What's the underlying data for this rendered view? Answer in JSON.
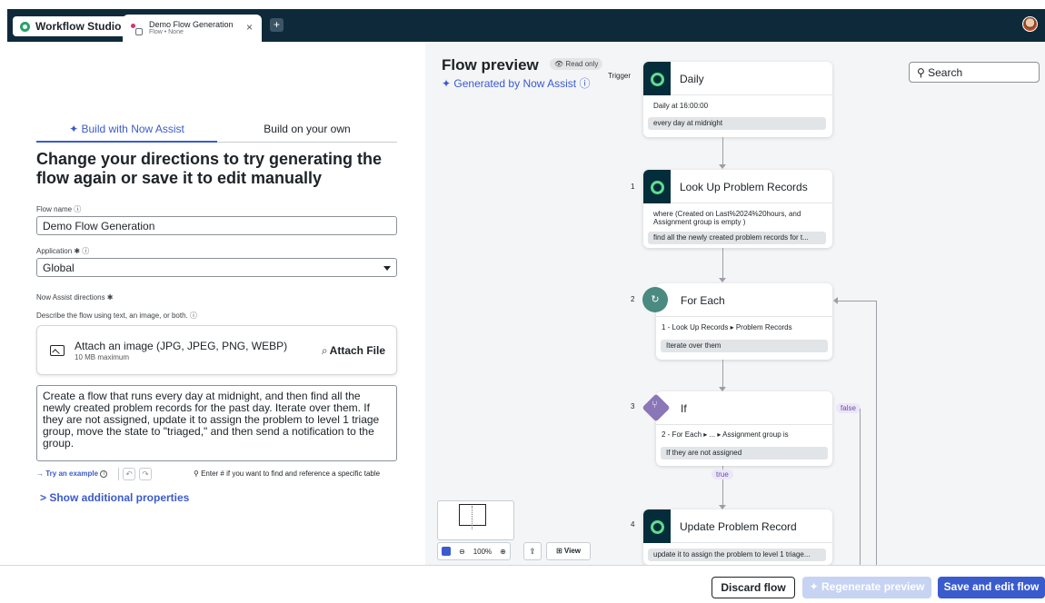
{
  "topbar": {
    "app_name": "Workflow Studio",
    "tab_title": "Demo Flow Generation",
    "tab_subtitle": "Flow • None",
    "tab_close": "×",
    "tab_add": "+"
  },
  "builder": {
    "tabs": [
      {
        "label": "✦ Build with Now Assist",
        "active": true
      },
      {
        "label": "Build on your own",
        "active": false
      }
    ],
    "heading": "Change your directions to try generating the flow again or save it to edit manually",
    "flow_name_label": "Flow name ⓘ",
    "flow_name_value": "Demo Flow Generation",
    "application_label": "Application ✱ ⓘ",
    "application_value": "Global",
    "directions_label": "Now Assist directions ✱",
    "directions_sublabel": "Describe the flow using text, an image, or both. ⓘ",
    "attach_title": "Attach an image (JPG, JPEG, PNG, WEBP)",
    "attach_subtitle": "10 MB maximum",
    "attach_button": "Attach File",
    "directions_text": "Create a flow that runs every day at midnight, and then find all the newly created problem records for the past day. Iterate over them. If they are not assigned, update it to assign the problem to level 1 triage group, move the state to \"triaged,\" and then send a notification to the group.",
    "try_example": "→ Try an example",
    "table_hint": "⚲  Enter # if you want to find and reference a specific table",
    "show_more": "> Show additional properties"
  },
  "preview": {
    "title": "Flow preview",
    "read_only": "👁 Read only",
    "generated_by": "✦ Generated by Now Assist ⓘ",
    "search_placeholder": "⚲ Search",
    "trigger_label": "Trigger",
    "steps": [
      {
        "num": "",
        "title": "Daily",
        "line1": "Daily at 16:00:00",
        "line2": "",
        "chip": "every day at midnight"
      },
      {
        "num": "1",
        "title": "Look Up Problem Records",
        "line1": "where (Created on Last%2024%20hours, and",
        "line2": "Assignment group is empty )",
        "chip": "find all the newly created problem records for t..."
      },
      {
        "num": "2",
        "title": "For Each",
        "line1": "1 - Look Up Records ▸ Problem Records",
        "line2": "",
        "chip": "Iterate over them"
      },
      {
        "num": "3",
        "title": "If",
        "line1": "2 - For Each ▸ ... ▸ Assignment group is",
        "line2": "",
        "chip": "If they are not assigned"
      },
      {
        "num": "4",
        "title": "Update Problem Record",
        "line1": "",
        "line2": "",
        "chip": "update it to assign the problem to level 1 triage..."
      }
    ],
    "false_tag": "false",
    "true_tag": "true",
    "zoom": "100%",
    "view_button": "⊞ View"
  },
  "footer": {
    "discard": "Discard flow",
    "regenerate": "✦ Regenerate preview",
    "save": "Save and edit flow"
  },
  "colors": {
    "accent": "#3a5bcd",
    "topbar": "#0e2a3a",
    "logo_green": "#5fdc8c",
    "loop_teal": "#4a8a80",
    "if_purple": "#8b76b8"
  }
}
